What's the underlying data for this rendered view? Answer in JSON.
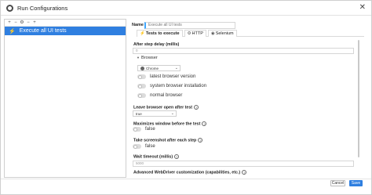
{
  "window": {
    "title": "Run Configurations",
    "close_label": "✕"
  },
  "sidebar": {
    "toolbar": [
      "+",
      "−",
      "⚙",
      "−",
      "+"
    ],
    "items": [
      {
        "label": "Execute all UI tests",
        "selected": true,
        "icon": "bolt-icon"
      }
    ]
  },
  "header": {
    "name_label": "Name",
    "name_value": "Execute all UI tests"
  },
  "tabs": [
    {
      "label": "Tests to execute",
      "icon": "bolt-icon",
      "active": true
    },
    {
      "label": "HTTP",
      "icon": "gear-icon",
      "active": false
    },
    {
      "label": "Selenium",
      "icon": "globe-icon",
      "active": false
    }
  ],
  "form": {
    "after_step_delay": {
      "label": "After step delay (millis)",
      "value": "0"
    },
    "browser_section": "Browser",
    "browser_select": "Chrome",
    "toggles_browser": [
      {
        "label": "latest browser version",
        "on": false
      },
      {
        "label": "system browser installation",
        "on": false
      },
      {
        "label": "normal browser",
        "on": false
      }
    ],
    "leave_open": {
      "label": "Leave browser open after test",
      "value": "true"
    },
    "maximize": {
      "label": "Maximizes window before the test",
      "state_text": "false"
    },
    "screenshot": {
      "label": "Take screenshot after each step",
      "state_text": "false"
    },
    "wait_timeout": {
      "label": "Wait timeout (millis)",
      "value": "5000"
    },
    "advanced": {
      "label": "Advanced WebDriver customization (capabilities, etc.)"
    }
  },
  "footer": {
    "cancel_label": "Cancel",
    "save_label": "Save"
  },
  "colors": {
    "accent": "#2f7fe0",
    "focus": "#3fa6ff"
  }
}
